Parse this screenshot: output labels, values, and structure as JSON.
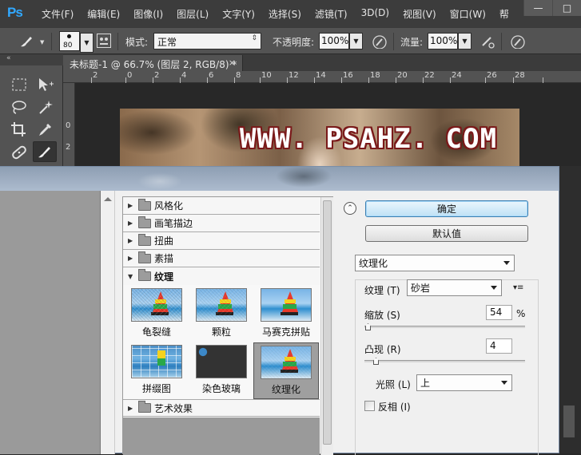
{
  "app": {
    "logo": "Ps"
  },
  "menu": [
    "文件(F)",
    "编辑(E)",
    "图像(I)",
    "图层(L)",
    "文字(Y)",
    "选择(S)",
    "滤镜(T)",
    "3D(D)",
    "视图(V)",
    "窗口(W)",
    "帮"
  ],
  "options": {
    "brush_size": "80",
    "mode_label": "模式:",
    "mode_value": "正常",
    "opacity_label": "不透明度:",
    "opacity_value": "100%",
    "flow_label": "流量:",
    "flow_value": "100%"
  },
  "document": {
    "tab_title": "未标题-1 @ 66.7% (图层 2, RGB/8) *",
    "ruler_h": [
      "2",
      "0",
      "2",
      "4",
      "6",
      "8",
      "10",
      "12",
      "14",
      "16",
      "18",
      "20",
      "22",
      "24",
      "26",
      "28"
    ],
    "ruler_v": [
      "0",
      "2"
    ],
    "watermark": "WWW. PSAHZ. COM"
  },
  "filter_gallery": {
    "categories_top": [
      "风格化",
      "画笔描边",
      "扭曲",
      "素描"
    ],
    "open_category": "纹理",
    "thumbnails": [
      "龟裂缝",
      "颗粒",
      "马赛克拼贴",
      "拼缀图",
      "染色玻璃",
      "纹理化"
    ],
    "selected_thumbnail": "纹理化",
    "categories_bottom": [
      "艺术效果"
    ],
    "ok_label": "确定",
    "default_label": "默认值",
    "filter_select": "纹理化",
    "texture_label": "纹理 (T)",
    "texture_value": "砂岩",
    "scaling_label": "缩放 (S)",
    "scaling_value": "54",
    "scaling_unit": "%",
    "relief_label": "凸现 (R)",
    "relief_value": "4",
    "light_label": "光照 (L)",
    "light_value": "上",
    "invert_label": "反相 (I)",
    "invert_checked": false
  }
}
